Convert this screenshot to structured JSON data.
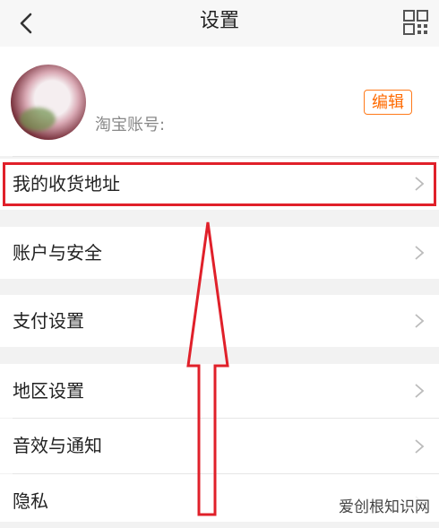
{
  "header": {
    "title": "设置",
    "back_icon": "chevron-left-icon",
    "right_icon": "grid-icon"
  },
  "profile": {
    "nickname": "",
    "account_label": "淘宝账号:",
    "account_value": "",
    "edit_label": "编辑",
    "accent_color": "#ff6a00"
  },
  "settings": {
    "address": "我的收货地址",
    "account_security": "账户与安全",
    "payment": "支付设置",
    "region": "地区设置",
    "sound_notify": "音效与通知",
    "privacy": "隐私"
  },
  "annotation": {
    "box_color": "#e0202a"
  },
  "watermark": "爱创根知识网"
}
